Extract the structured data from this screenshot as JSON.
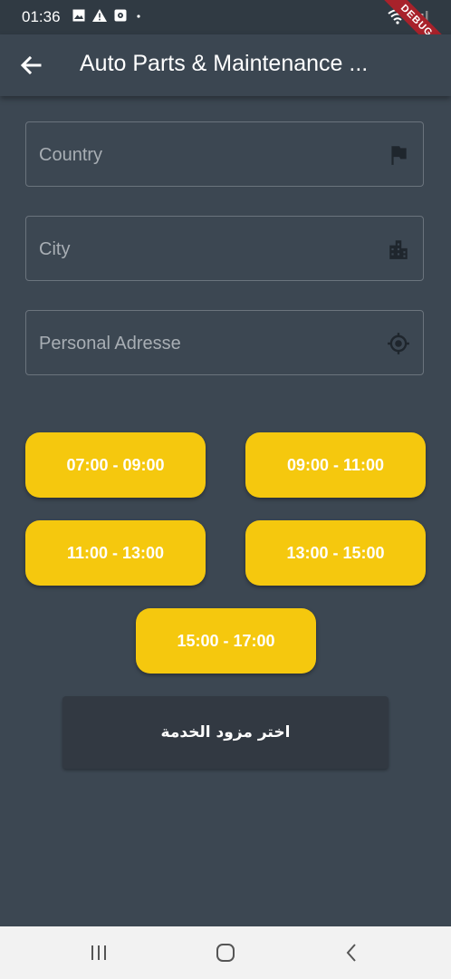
{
  "status_bar": {
    "time": "01:36",
    "left_icons": [
      "image-icon",
      "warning-icon",
      "notification-icon",
      "dot-icon"
    ],
    "right_icons": [
      "wifi-icon",
      "signal-icon"
    ]
  },
  "debug_banner": "DEBUG",
  "app_bar": {
    "title": "Auto Parts & Maintenance ...",
    "back_icon": "arrow-left-icon"
  },
  "form": {
    "country": {
      "placeholder": "Country",
      "value": "",
      "icon": "flag-icon"
    },
    "city": {
      "placeholder": "City",
      "value": "",
      "icon": "city-icon"
    },
    "address": {
      "placeholder": "Personal Adresse",
      "value": "",
      "icon": "location-target-icon"
    }
  },
  "time_slots": [
    "07:00 - 09:00",
    "09:00 - 11:00",
    "11:00 - 13:00",
    "13:00 - 15:00",
    "15:00 - 17:00"
  ],
  "provider_button": "اختر مزود الخدمة",
  "colors": {
    "background": "#3c4752",
    "app_bar": "#3b4651",
    "slot_accent": "#f5c80e",
    "provider_button": "#323942",
    "debug_banner": "#a8222b"
  },
  "nav_bar": {
    "buttons": [
      "recent-apps-icon",
      "home-icon",
      "back-icon"
    ]
  }
}
